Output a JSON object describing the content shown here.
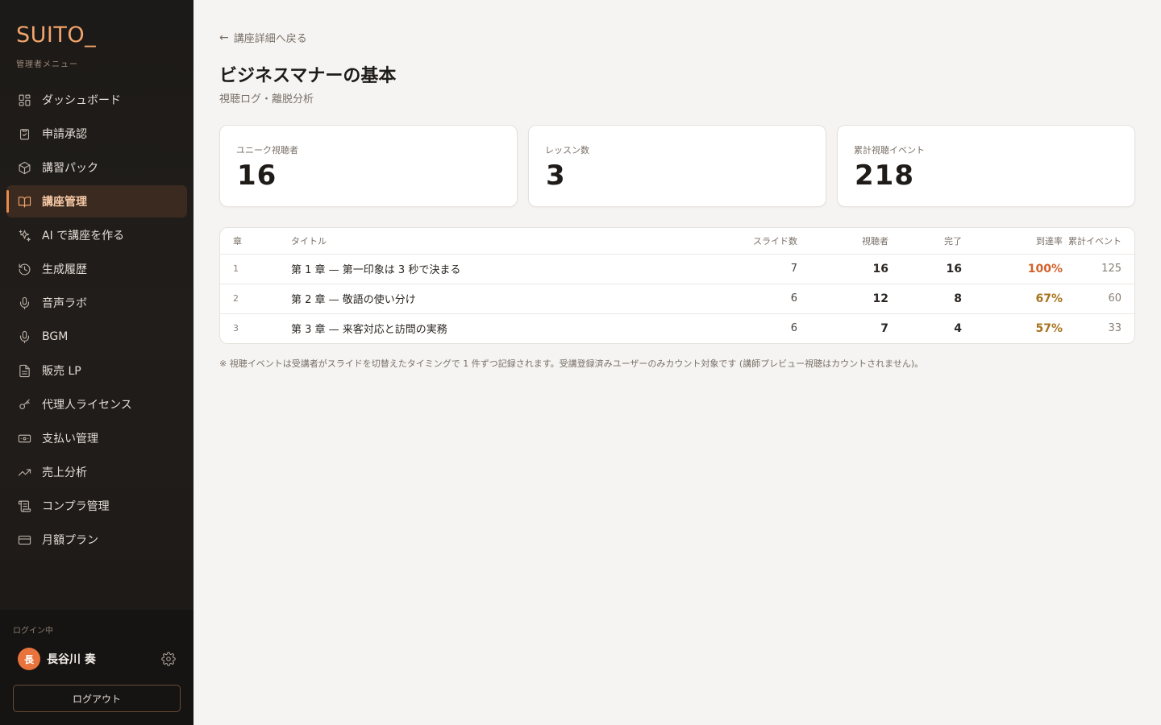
{
  "brand": {
    "logo": "SUITO_",
    "subtitle": "管理者メニュー"
  },
  "nav": [
    {
      "label": "ダッシュボード",
      "icon": "grid-icon",
      "active": false
    },
    {
      "label": "申請承認",
      "icon": "clipboard-check-icon",
      "active": false
    },
    {
      "label": "講習パック",
      "icon": "box-icon",
      "active": false
    },
    {
      "label": "講座管理",
      "icon": "book-open-icon",
      "active": true
    },
    {
      "label": "AI で講座を作る",
      "icon": "sparkles-icon",
      "active": false
    },
    {
      "label": "生成履歴",
      "icon": "history-icon",
      "active": false
    },
    {
      "label": "音声ラボ",
      "icon": "mic-icon",
      "active": false
    },
    {
      "label": "BGM",
      "icon": "mic-icon",
      "active": false
    },
    {
      "label": "販売 LP",
      "icon": "file-icon",
      "active": false
    },
    {
      "label": "代理人ライセンス",
      "icon": "key-icon",
      "active": false
    },
    {
      "label": "支払い管理",
      "icon": "banknote-icon",
      "active": false
    },
    {
      "label": "売上分析",
      "icon": "trending-up-icon",
      "active": false
    },
    {
      "label": "コンプラ管理",
      "icon": "scroll-icon",
      "active": false
    },
    {
      "label": "月額プラン",
      "icon": "credit-card-icon",
      "active": false
    }
  ],
  "footer": {
    "login_label": "ログイン中",
    "avatar_initial": "長",
    "user_name": "長谷川 奏",
    "logout_label": "ログアウト"
  },
  "main": {
    "back_label": "講座詳細へ戻る",
    "title": "ビジネスマナーの基本",
    "subtitle": "視聴ログ・離脱分析",
    "stats": [
      {
        "label": "ユニーク視聴者",
        "value": "16"
      },
      {
        "label": "レッスン数",
        "value": "3"
      },
      {
        "label": "累計視聴イベント",
        "value": "218"
      }
    ],
    "table": {
      "headers": {
        "chapter": "章",
        "title": "タイトル",
        "slides": "スライド数",
        "viewers": "視聴者",
        "completed": "完了",
        "rate": "到達率",
        "events": "累計イベント"
      },
      "rows": [
        {
          "chapter": "1",
          "title": "第 1 章 — 第一印象は 3 秒で決まる",
          "slides": "7",
          "viewers": "16",
          "completed": "16",
          "rate": "100%",
          "events": "125"
        },
        {
          "chapter": "2",
          "title": "第 2 章 — 敬語の使い分け",
          "slides": "6",
          "viewers": "12",
          "completed": "8",
          "rate": "67%",
          "events": "60"
        },
        {
          "chapter": "3",
          "title": "第 3 章 — 来客対応と訪問の実務",
          "slides": "6",
          "viewers": "7",
          "completed": "4",
          "rate": "57%",
          "events": "33"
        }
      ]
    },
    "note": "※ 視聴イベントは受講者がスライドを切替えたタイミングで 1 件ずつ記録されます。受講登録済みユーザーのみカウント対象です (講師プレビュー視聴はカウントされません)。"
  },
  "colors": {
    "accent": "#f2a46c",
    "rate_full": "#d4622a",
    "rate_mid": "#a7741f"
  }
}
